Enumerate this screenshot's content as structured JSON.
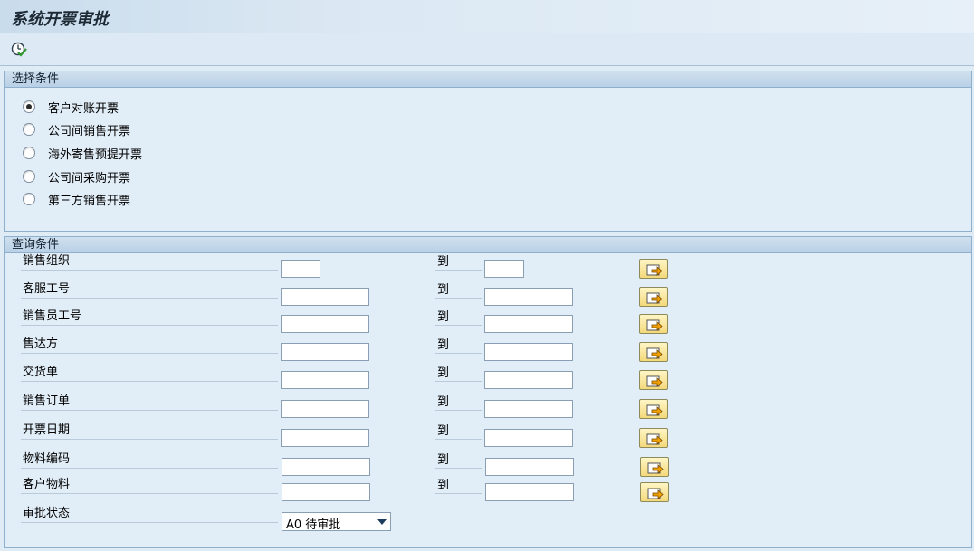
{
  "window": {
    "title": "系统开票审批"
  },
  "toolbar": {
    "execute_icon": "execute-clock-check-icon"
  },
  "selection_group": {
    "header": "选择条件",
    "options": [
      {
        "label": "客户对账开票",
        "checked": true
      },
      {
        "label": "公司间销售开票",
        "checked": false
      },
      {
        "label": "海外寄售预提开票",
        "checked": false
      },
      {
        "label": "公司间采购开票",
        "checked": false
      },
      {
        "label": "第三方销售开票",
        "checked": false
      }
    ]
  },
  "query_group": {
    "header": "查询条件",
    "to_label": "到",
    "fields": [
      {
        "label": "销售组织",
        "from": "",
        "to": ""
      },
      {
        "label": "客服工号",
        "from": "",
        "to": ""
      },
      {
        "label": "销售员工号",
        "from": "",
        "to": ""
      },
      {
        "label": "售达方",
        "from": "",
        "to": ""
      },
      {
        "label": "交货单",
        "from": "",
        "to": ""
      },
      {
        "label": "销售订单",
        "from": "",
        "to": ""
      },
      {
        "label": "开票日期",
        "from": "",
        "to": ""
      },
      {
        "label": "物料编码",
        "from": "",
        "to": ""
      },
      {
        "label": "客户物料",
        "from": "",
        "to": ""
      }
    ],
    "status": {
      "label": "审批状态",
      "value": "A0 待审批"
    }
  },
  "colors": {
    "background": "#dfebf5",
    "group_border": "#8fb0cd",
    "button_yellow": "#f4d97a"
  }
}
